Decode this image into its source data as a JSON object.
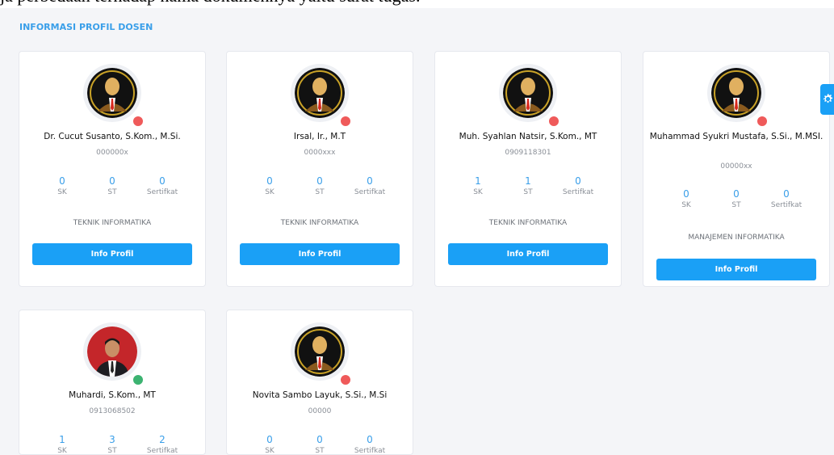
{
  "doc_text": "ja perbedaan terhadap nama dokumennya yaitu surat tugas.",
  "section_title": "INFORMASI PROFIL DOSEN",
  "labels": {
    "sk": "SK",
    "st": "ST",
    "sertifikat": "Sertifkat",
    "button": "Info Profil"
  },
  "colors": {
    "accent": "#1aa0f6",
    "offline": "#ef5a5a",
    "online": "#3cb371"
  },
  "cards": [
    {
      "name": "Dr. Cucut Susanto, S.Kom., M.Si.",
      "nip": "000000x",
      "sk": "0",
      "st": "0",
      "sertifikat": "0",
      "prodi": "TEKNIK INFORMATIKA",
      "status": "offline"
    },
    {
      "name": "Irsal, Ir., M.T",
      "nip": "0000xxx",
      "sk": "0",
      "st": "0",
      "sertifikat": "0",
      "prodi": "TEKNIK INFORMATIKA",
      "status": "offline"
    },
    {
      "name": "Muh. Syahlan Natsir, S.Kom., MT",
      "nip": "0909118301",
      "sk": "1",
      "st": "1",
      "sertifikat": "0",
      "prodi": "TEKNIK INFORMATIKA",
      "status": "offline"
    },
    {
      "name": "Muhammad Syukri Mustafa, S.Si., M.MSI.",
      "nip": "00000xx",
      "sk": "0",
      "st": "0",
      "sertifikat": "0",
      "prodi": "MANAJEMEN INFORMATIKA",
      "status": "offline"
    },
    {
      "name": "Muhardi, S.Kom., MT",
      "nip": "0913068502",
      "sk": "1",
      "st": "3",
      "sertifikat": "2",
      "prodi": "",
      "status": "online"
    },
    {
      "name": "Novita Sambo Layuk, S.Si., M.Si",
      "nip": "00000",
      "sk": "0",
      "st": "0",
      "sertifikat": "0",
      "prodi": "",
      "status": "offline"
    }
  ],
  "icons": {
    "avatar_placeholder": "user-silhouette-icon",
    "photo": "user-photo-icon",
    "settings": "gear-icon"
  }
}
